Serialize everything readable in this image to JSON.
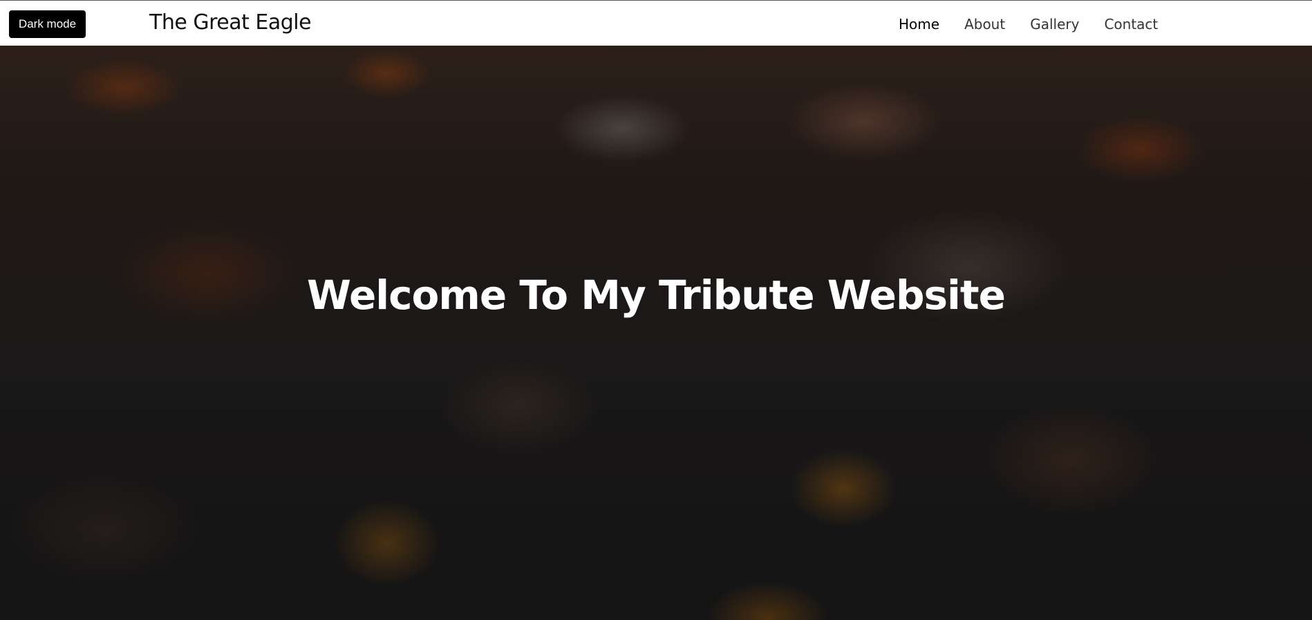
{
  "header": {
    "dark_mode_label": "Dark mode",
    "brand": "The Great Eagle",
    "nav": [
      {
        "label": "Home",
        "active": true
      },
      {
        "label": "About",
        "active": false
      },
      {
        "label": "Gallery",
        "active": false
      },
      {
        "label": "Contact",
        "active": false
      }
    ]
  },
  "hero": {
    "title": "Welcome To My Tribute Website"
  },
  "colors": {
    "header_bg": "#ffffff",
    "toggle_bg": "#000000",
    "hero_text": "#ffffff"
  }
}
